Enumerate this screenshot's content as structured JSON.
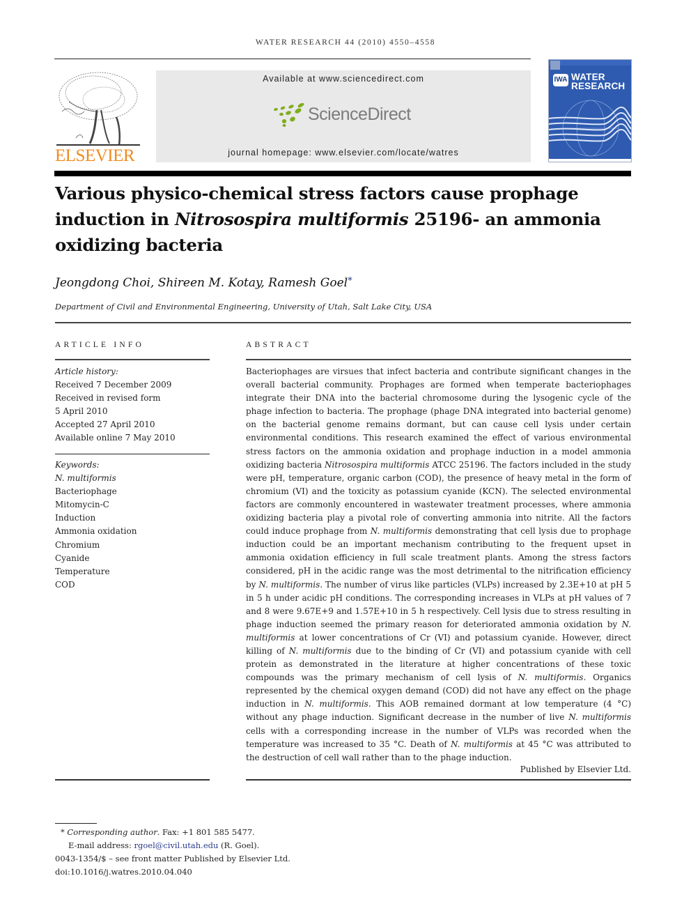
{
  "header": {
    "running_head": "WATER RESEARCH 44 (2010) 4550–4558",
    "publisher_logo_text": "ELSEVIER",
    "banner": {
      "available_at": "Available at www.sciencedirect.com",
      "sciencedirect_logo_text": "ScienceDirect",
      "journal_homepage": "journal homepage: www.elsevier.com/locate/watres"
    },
    "cover": {
      "badge": "IWA",
      "title_line1": "WATER",
      "title_line2": "RESEARCH"
    },
    "colors": {
      "elsevier_orange": "#f08a1e",
      "sciencedirect_green": "#7fae1e",
      "cover_blue": "#2e5bb0",
      "banner_gray": "#e9e9e9",
      "link_blue": "#2a3a8a"
    }
  },
  "article": {
    "title_part1": "Various physico-chemical stress factors cause prophage induction in ",
    "title_italic": "Nitrosospira multiformis",
    "title_part2": " 25196- an ammonia oxidizing bacteria",
    "authors": "Jeongdong Choi, Shireen M. Kotay, Ramesh Goel",
    "corresponding_mark": "*",
    "affiliation": "Department of Civil and Environmental Engineering, University of Utah, Salt Lake City, USA"
  },
  "article_info": {
    "heading": "ARTICLE INFO",
    "history_label": "Article history:",
    "history": [
      "Received 7 December 2009",
      "Received in revised form",
      "5 April 2010",
      "Accepted 27 April 2010",
      "Available online 7 May 2010"
    ],
    "keywords_label": "Keywords:",
    "keywords": [
      "N. multiformis",
      "Bacteriophage",
      "Mitomycin-C",
      "Induction",
      "Ammonia oxidation",
      "Chromium",
      "Cyanide",
      "Temperature",
      "COD"
    ]
  },
  "abstract": {
    "heading": "ABSTRACT",
    "segments": [
      {
        "t": "Bacteriophages are virsues that infect bacteria and contribute significant changes in the overall bacterial community. Prophages are formed when temperate bacteriophages integrate their DNA into the bacterial chromosome during the lysogenic cycle of the phage infection to bacteria. The prophage (phage DNA integrated into bacterial genome) on the bacterial genome remains dormant, but can cause cell lysis under certain environmental conditions. This research examined the effect of various environmental stress factors on the ammonia oxidation and prophage induction in a model ammonia oxidizing bacteria ",
        "i": false
      },
      {
        "t": "Nitrosospira multiformis",
        "i": true
      },
      {
        "t": " ATCC 25196. The factors included in the study were pH, temperature, organic carbon (COD), the presence of heavy metal in the form of chromium (VI) and the toxicity as potassium cyanide (KCN). The selected environmental factors are commonly encountered in wastewater treatment processes, where ammonia oxidizing bacteria play a pivotal role of converting ammonia into nitrite. All the factors could induce prophage from ",
        "i": false
      },
      {
        "t": "N. multiformis",
        "i": true
      },
      {
        "t": " demonstrating that cell lysis due to prophage induction could be an important mechanism contributing to the frequent upset in ammonia oxidation efficiency in full scale treatment plants. Among the stress factors considered, pH in the acidic range was the most detrimental to the nitrification efficiency by ",
        "i": false
      },
      {
        "t": "N. multiformis",
        "i": true
      },
      {
        "t": ". The number of virus like particles (VLPs) increased by 2.3E+10 at pH 5 in 5 h under acidic pH conditions. The corresponding increases in VLPs at pH values of 7 and 8 were 9.67E+9 and 1.57E+10 in 5 h respectively. Cell lysis due to stress resulting in phage induction seemed the primary reason for deteriorated ammonia oxidation by ",
        "i": false
      },
      {
        "t": "N. multiformis",
        "i": true
      },
      {
        "t": " at lower concentrations of Cr (VI) and potassium cyanide. However, direct killing of ",
        "i": false
      },
      {
        "t": "N. multiformis",
        "i": true
      },
      {
        "t": " due to the binding of Cr (VI) and potassium cyanide with cell protein as demonstrated in the literature at higher concentrations of these toxic compounds was the primary mechanism of cell lysis of ",
        "i": false
      },
      {
        "t": "N. multiformis",
        "i": true
      },
      {
        "t": ". Organics represented by the chemical oxygen demand (COD) did not have any effect on the phage induction in ",
        "i": false
      },
      {
        "t": "N. multiformis",
        "i": true
      },
      {
        "t": ". This AOB remained dormant at low temperature (4 °C) without any phage induction. Significant decrease in the number of live ",
        "i": false
      },
      {
        "t": "N. multiformis",
        "i": true
      },
      {
        "t": " cells with a corresponding increase in the number of VLPs was recorded when the temperature was increased to 35 °C. Death of ",
        "i": false
      },
      {
        "t": "N. multiformis",
        "i": true
      },
      {
        "t": " at 45 °C was attributed to the destruction of cell wall rather than to the phage induction.",
        "i": false
      }
    ],
    "published_by": "Published by Elsevier Ltd."
  },
  "footnotes": {
    "star": "*",
    "corresponding_label": "Corresponding author",
    "fax": ". Fax: +1 801 585 5477.",
    "email_label": "E-mail address: ",
    "email": "rgoel@civil.utah.edu",
    "email_suffix": " (R. Goel).",
    "issn_line": "0043-1354/$ – see front matter Published by Elsevier Ltd.",
    "doi": "doi:10.1016/j.watres.2010.04.040"
  }
}
